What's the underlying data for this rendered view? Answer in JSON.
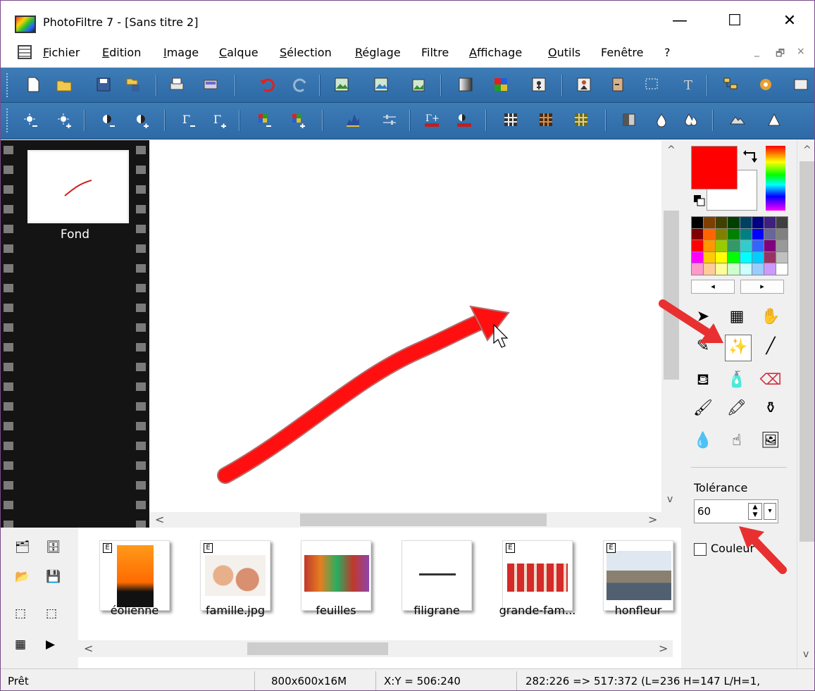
{
  "window": {
    "title": "PhotoFiltre 7 - [Sans titre 2]",
    "minimize": "—",
    "maximize": "☐",
    "close": "✕"
  },
  "menu": {
    "items": [
      {
        "label": "Fichier",
        "ul": "F",
        "rest": "ichier"
      },
      {
        "label": "Edition",
        "ul": "E",
        "rest": "dition"
      },
      {
        "label": "Image",
        "ul": "I",
        "rest": "mage"
      },
      {
        "label": "Calque",
        "ul": "C",
        "rest": "alque"
      },
      {
        "label": "Sélection",
        "ul": "S",
        "rest": "élection"
      },
      {
        "label": "Réglage",
        "ul": "R",
        "rest": "églage"
      },
      {
        "label": "Filtre"
      },
      {
        "label": "Affichage",
        "ul": "A",
        "rest": "ffichage"
      },
      {
        "label": "Outils",
        "ul": "O",
        "rest": "utils"
      },
      {
        "label": "Fenêtre"
      },
      {
        "label": "?"
      }
    ],
    "mdi_min": "_",
    "mdi_restore": "🗗",
    "mdi_close": "×"
  },
  "layers": {
    "name": "Fond"
  },
  "tolerance": {
    "label": "Tolérance",
    "value": "60"
  },
  "couleur": {
    "label": "Couleur"
  },
  "filmstrip": {
    "items": [
      {
        "label": "éolienne",
        "edited": "E"
      },
      {
        "label": "famille.jpg",
        "edited": "E"
      },
      {
        "label": "feuilles",
        "edited": ""
      },
      {
        "label": "filigrane",
        "edited": ""
      },
      {
        "label": "grande-fam...",
        "edited": "E"
      },
      {
        "label": "honfleur",
        "edited": "E"
      }
    ]
  },
  "status": {
    "ready": "Prêt",
    "size": "800x600x16M",
    "coords": "X:Y = 506:240",
    "selection": "282:226 => 517:372 (L=236  H=147  L/H=1,"
  },
  "colors": {
    "foreground": "#ff0000",
    "background": "#ffffff",
    "toolbar": "#3a78b4",
    "film": "#141414"
  }
}
